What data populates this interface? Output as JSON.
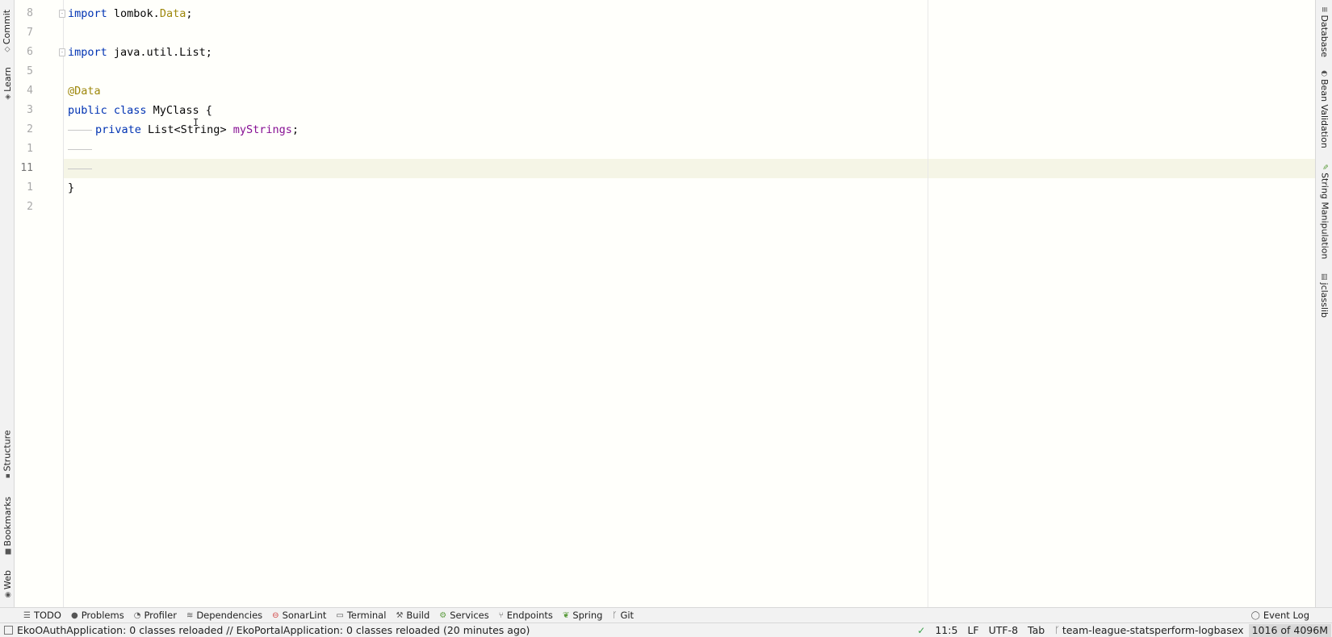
{
  "left_strip": {
    "tabs": [
      {
        "label": "Commit",
        "icon": "commit-icon"
      },
      {
        "label": "Learn",
        "icon": "learn-icon"
      },
      {
        "label": "Structure",
        "icon": "structure-icon"
      },
      {
        "label": "Bookmarks",
        "icon": "bookmark-icon"
      },
      {
        "label": "Web",
        "icon": "web-icon"
      }
    ]
  },
  "right_strip": {
    "tabs": [
      {
        "label": "Database",
        "icon": "database-icon"
      },
      {
        "label": "Bean Validation",
        "icon": "bean-validation-icon"
      },
      {
        "label": "String Manipulation",
        "icon": "pencil-icon"
      },
      {
        "label": "jclasslib",
        "icon": "jclasslib-icon"
      }
    ]
  },
  "editor": {
    "line_numbers": [
      "8",
      "7",
      "6",
      "5",
      "4",
      "3",
      "2",
      "1",
      "11",
      "1",
      "2"
    ],
    "lines": {
      "l0_kw": "import",
      "l0_pkg": " lombok.",
      "l0_cls": "Data",
      "l0_end": ";",
      "l2_kw": "import",
      "l2_rest": " java.util.List;",
      "l4_ann": "@Data",
      "l5_kw": "public class",
      "l5_rest": " MyClass {",
      "l6_kw": "private",
      "l6_type": " List<String> ",
      "l6_field": "myStrings",
      "l6_end": ";",
      "l9_brace": "}"
    }
  },
  "tool_bar": {
    "items": [
      {
        "label": "TODO",
        "icon": "list-icon"
      },
      {
        "label": "Problems",
        "icon": "problems-icon"
      },
      {
        "label": "Profiler",
        "icon": "profiler-icon"
      },
      {
        "label": "Dependencies",
        "icon": "dependencies-icon"
      },
      {
        "label": "SonarLint",
        "icon": "sonarlint-icon"
      },
      {
        "label": "Terminal",
        "icon": "terminal-icon"
      },
      {
        "label": "Build",
        "icon": "hammer-icon"
      },
      {
        "label": "Services",
        "icon": "services-icon"
      },
      {
        "label": "Endpoints",
        "icon": "endpoints-icon"
      },
      {
        "label": "Spring",
        "icon": "spring-icon"
      },
      {
        "label": "Git",
        "icon": "git-branch-icon"
      }
    ],
    "event_log": "Event Log"
  },
  "status_bar": {
    "message": "EkoOAuthApplication: 0 classes reloaded // EkoPortalApplication: 0 classes reloaded (20 minutes ago)",
    "position": "11:5",
    "line_separator": "LF",
    "encoding": "UTF-8",
    "indent": "Tab",
    "branch": "team-league-statsperform-logbasex",
    "memory": "1016 of 4096M"
  }
}
